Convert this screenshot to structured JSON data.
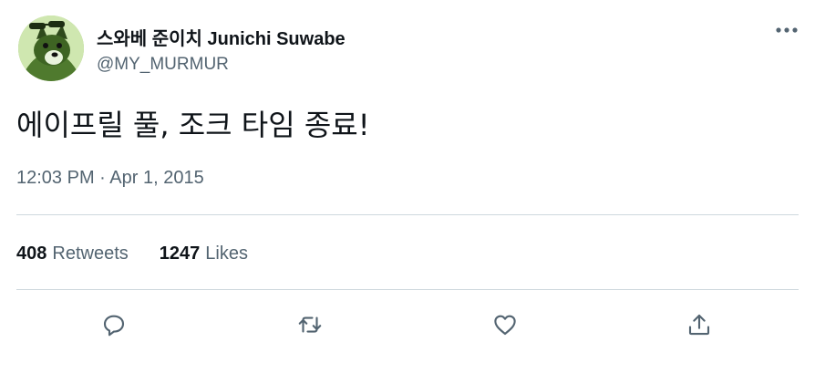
{
  "author": {
    "display_name": "스와베 준이치 Junichi Suwabe",
    "handle": "@MY_MURMUR",
    "avatar_icon": "dog-with-sunglasses-avatar"
  },
  "tweet": {
    "text": "에이프릴 풀, 조크 타임 종료!",
    "time": "12:03 PM",
    "separator": "·",
    "date": "Apr 1, 2015"
  },
  "stats": {
    "retweets_count": "408",
    "retweets_label": "Retweets",
    "likes_count": "1247",
    "likes_label": "Likes"
  },
  "actions": {
    "reply_icon": "speech-bubble-icon",
    "retweet_icon": "retweet-arrows-icon",
    "like_icon": "heart-icon",
    "share_icon": "share-upload-icon"
  },
  "colors": {
    "text_primary": "#0f1419",
    "text_secondary": "#536471",
    "divider": "#cfd9de",
    "background": "#ffffff"
  }
}
